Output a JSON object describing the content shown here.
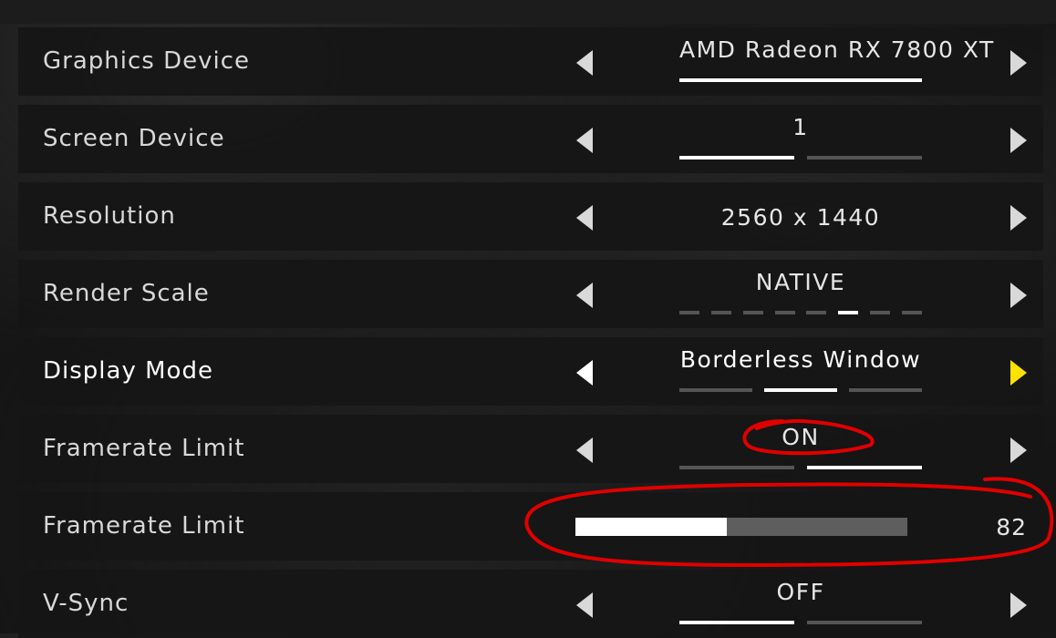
{
  "settings": [
    {
      "label": "Graphics Device",
      "value": "AMD Radeon RX 7800 XT",
      "indicator": {
        "count": 1,
        "active": 0
      }
    },
    {
      "label": "Screen Device",
      "value": "1",
      "indicator": {
        "count": 2,
        "active": 0
      }
    },
    {
      "label": "Resolution",
      "value": "2560 x 1440"
    },
    {
      "label": "Render Scale",
      "value": "NATIVE",
      "indicator": {
        "count": 8,
        "active": 5
      }
    },
    {
      "label": "Display Mode",
      "value": "Borderless Window",
      "indicator": {
        "count": 3,
        "active": 1
      },
      "highlighted": true
    },
    {
      "label": "Framerate Limit",
      "value": "ON",
      "indicator": {
        "count": 2,
        "active": 1
      }
    },
    {
      "label": "Framerate Limit",
      "slider_value": "82",
      "slider_fraction": 0.455
    },
    {
      "label": "V-Sync",
      "value": "OFF",
      "indicator": {
        "count": 2,
        "active": 0
      }
    }
  ],
  "colors": {
    "accent_arrow": "#ffe100",
    "annotation": "#e00000"
  }
}
